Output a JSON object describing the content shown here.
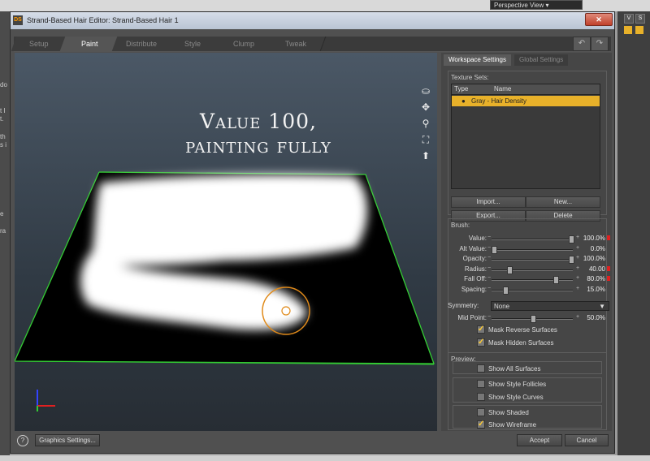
{
  "background_app": {
    "perspective_view": "Perspective View",
    "right_labels": [
      "V",
      "S"
    ],
    "left_fragments": [
      "do",
      "t I",
      "t.",
      "th",
      "s i",
      "e",
      "ra"
    ]
  },
  "dialog": {
    "title": "Strand-Based Hair Editor: Strand-Based Hair 1",
    "logo": "DS",
    "close": "✕",
    "tabs": [
      "Setup",
      "Paint",
      "Distribute",
      "Style",
      "Clump",
      "Tweak"
    ],
    "active_tab": "Paint",
    "undo": "↶",
    "redo": "↷"
  },
  "viewport": {
    "caption_line1": "Value 100,",
    "caption_line2": "painting fully",
    "wireframe_color": "#33cc33",
    "brush_color": "#e08a1a"
  },
  "panel": {
    "tabs": [
      "Workspace Settings",
      "Global Settings"
    ],
    "texture_sets_label": "Texture Sets:",
    "table_headers": [
      "Type",
      "Name"
    ],
    "rows": [
      {
        "type": "●",
        "name": "Gray - Hair Density"
      }
    ],
    "buttons": {
      "import": "Import...",
      "new": "New...",
      "export": "Export...",
      "delete": "Delete"
    },
    "brush_label": "Brush:",
    "sliders": [
      {
        "label": "Value:",
        "value": "100.0%",
        "level": 1.0,
        "marked": true
      },
      {
        "label": "Alt Value:",
        "value": "0.0%",
        "level": 0.0,
        "marked": false
      },
      {
        "label": "Opacity:",
        "value": "100.0%",
        "level": 1.0,
        "marked": false
      },
      {
        "label": "Radius:",
        "value": "40.00",
        "level": 0.2,
        "marked": true
      },
      {
        "label": "Fall Off:",
        "value": "80.0%",
        "level": 0.8,
        "marked": true
      },
      {
        "label": "Spacing:",
        "value": "15.0%",
        "level": 0.15,
        "marked": false
      }
    ],
    "symmetry_label": "Symmetry:",
    "symmetry_value": "None",
    "midpoint": {
      "label": "Mid Point:",
      "value": "50.0%",
      "level": 0.5
    },
    "brush_checks": [
      {
        "label": "Mask Reverse Surfaces",
        "checked": true
      },
      {
        "label": "Mask Hidden Surfaces",
        "checked": true
      }
    ],
    "preview_label": "Preview:",
    "preview_checks": [
      {
        "label": "Show All Surfaces",
        "checked": false
      },
      {
        "label": "Show Style Follicles",
        "checked": false
      },
      {
        "label": "Show Style Curves",
        "checked": false
      },
      {
        "label": "Show Shaded",
        "checked": false
      },
      {
        "label": "Show Wireframe",
        "checked": true
      }
    ]
  },
  "footer": {
    "help": "?",
    "graphics_settings": "Graphics Settings...",
    "accept": "Accept",
    "cancel": "Cancel"
  }
}
